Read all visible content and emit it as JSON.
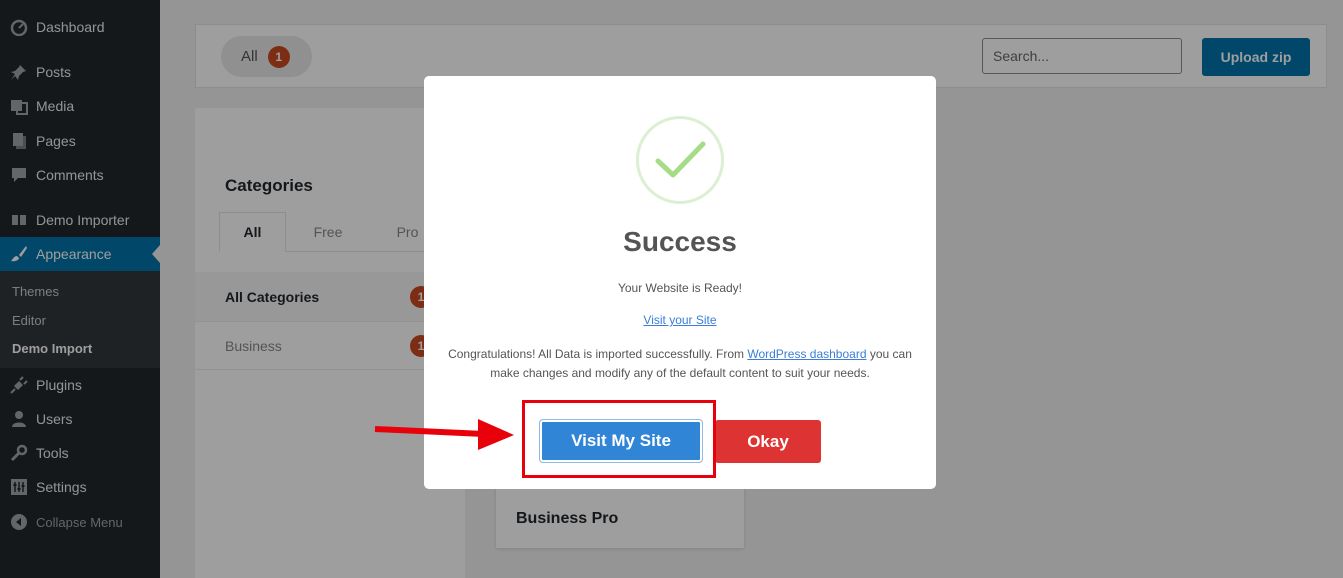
{
  "sidebar": {
    "items": [
      {
        "label": "Dashboard",
        "icon": "dashboard-icon"
      },
      {
        "label": "Posts",
        "icon": "pin-icon"
      },
      {
        "label": "Media",
        "icon": "media-icon"
      },
      {
        "label": "Pages",
        "icon": "pages-icon"
      },
      {
        "label": "Comments",
        "icon": "comment-icon"
      },
      {
        "label": "Demo Importer",
        "icon": "columns-icon"
      },
      {
        "label": "Appearance",
        "icon": "brush-icon"
      },
      {
        "label": "Plugins",
        "icon": "plugin-icon"
      },
      {
        "label": "Users",
        "icon": "user-icon"
      },
      {
        "label": "Tools",
        "icon": "wrench-icon"
      },
      {
        "label": "Settings",
        "icon": "settings-icon"
      },
      {
        "label": "Collapse Menu",
        "icon": "collapse-icon"
      }
    ],
    "submenu": [
      "Themes",
      "Editor",
      "Demo Import"
    ],
    "active_color": "#0073aa"
  },
  "toolbar": {
    "filter_label": "All",
    "filter_count": "1",
    "search_placeholder": "Search...",
    "upload_label": "Upload zip"
  },
  "categories": {
    "heading": "Categories",
    "tabs": [
      "All",
      "Free",
      "Pro"
    ],
    "rows": [
      {
        "label": "All Categories",
        "count": "1"
      },
      {
        "label": "Business",
        "count": "1"
      }
    ]
  },
  "card": {
    "title": "Business Pro"
  },
  "modal": {
    "title": "Success",
    "subtitle": "Your Website is Ready!",
    "visit_link": "Visit your Site",
    "congrats_prefix": "Congratulations! All Data is imported successfully. From ",
    "dashboard_link": "WordPress dashboard",
    "congrats_suffix": " you can make changes and modify any of the default content to suit your needs.",
    "visit_button": "Visit My Site",
    "okay_button": "Okay",
    "visit_color": "#3085d6",
    "okay_color": "#dd3333"
  },
  "annotation": {
    "highlight_color": "#e8000b"
  }
}
